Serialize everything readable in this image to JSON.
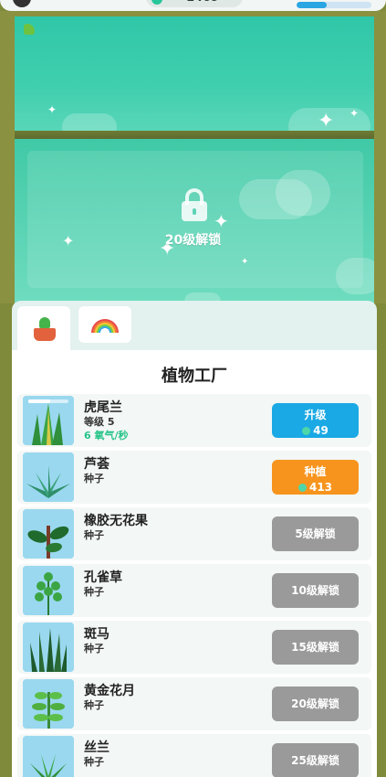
{
  "topbar": {
    "currency_amount": "1409",
    "progress_fraction": 0.4
  },
  "scene": {
    "locked_slot_text": "20级解锁"
  },
  "tabs": [
    {
      "id": "plants",
      "icon": "potted-cactus-icon",
      "active": true
    },
    {
      "id": "rainbow",
      "icon": "rainbow-icon",
      "active": false
    }
  ],
  "factory": {
    "title": "植物工厂",
    "plants": [
      {
        "name": "虎尾兰",
        "sub": "等级 5",
        "rate": "6 氧气/秒",
        "button": {
          "label": "升级",
          "cost": "49",
          "style": "blue"
        },
        "icon": "snake-plant-icon"
      },
      {
        "name": "芦荟",
        "sub": "种子",
        "button": {
          "label": "种植",
          "cost": "413",
          "style": "orange"
        },
        "icon": "aloe-icon"
      },
      {
        "name": "橡胶无花果",
        "sub": "种子",
        "button": {
          "label": "5级解锁",
          "style": "gray"
        },
        "icon": "rubber-fig-icon"
      },
      {
        "name": "孔雀草",
        "sub": "种子",
        "button": {
          "label": "10级解锁",
          "style": "gray"
        },
        "icon": "peacock-plant-icon"
      },
      {
        "name": "斑马",
        "sub": "种子",
        "button": {
          "label": "15级解锁",
          "style": "gray"
        },
        "icon": "zebra-plant-icon"
      },
      {
        "name": "黄金花月",
        "sub": "种子",
        "button": {
          "label": "20级解锁",
          "style": "gray"
        },
        "icon": "jade-plant-icon"
      },
      {
        "name": "丝兰",
        "sub": "种子",
        "button": {
          "label": "25级解锁",
          "style": "gray"
        },
        "icon": "yucca-icon"
      }
    ]
  },
  "colors": {
    "sky": "#2fc7a8",
    "upgrade_button": "#1aa9e4",
    "plant_button": "#f7941d",
    "locked_button": "#9a9a9a",
    "oxygen_text": "#28c489"
  }
}
